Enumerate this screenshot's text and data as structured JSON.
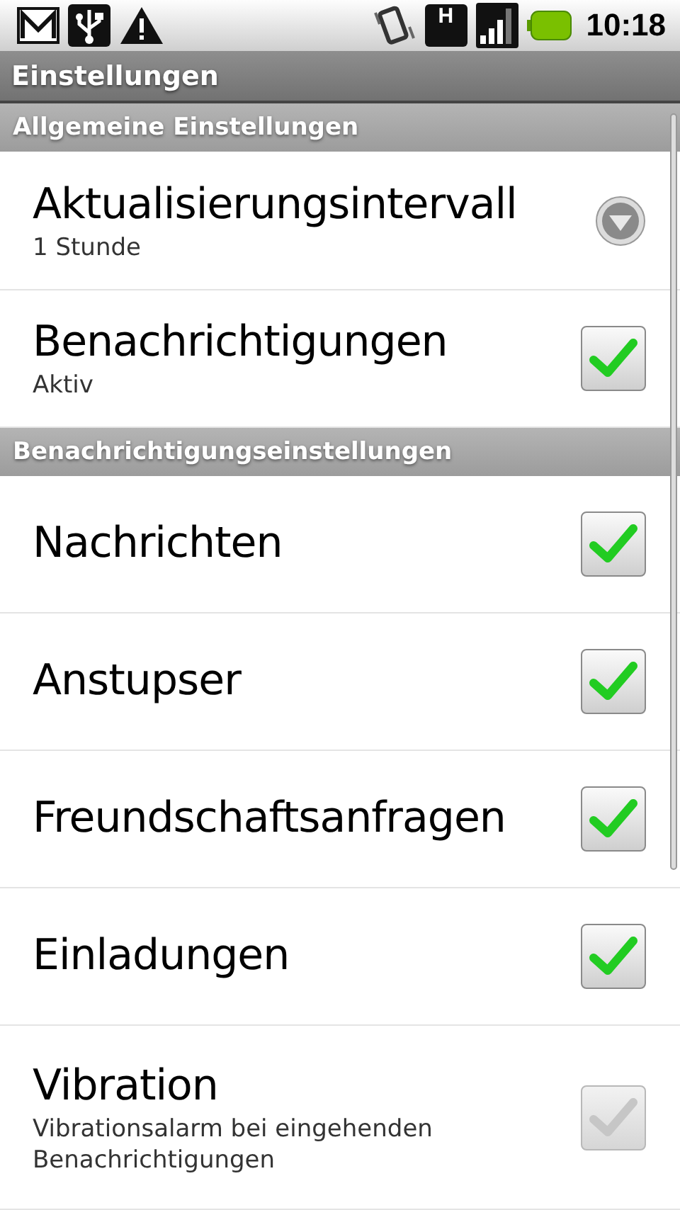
{
  "status_bar": {
    "network": "H",
    "time": "10:18"
  },
  "title": "Einstellungen",
  "sections": [
    {
      "header": "Allgemeine Einstellungen",
      "items": [
        {
          "kind": "list",
          "title": "Aktualisierungsintervall",
          "summary": "1 Stunde"
        },
        {
          "kind": "checkbox",
          "title": "Benachrichtigungen",
          "summary": "Aktiv",
          "checked": true,
          "disabled": false
        }
      ]
    },
    {
      "header": "Benachrichtigungseinstellungen",
      "items": [
        {
          "kind": "checkbox",
          "title": "Nachrichten",
          "checked": true,
          "disabled": false
        },
        {
          "kind": "checkbox",
          "title": "Anstupser",
          "checked": true,
          "disabled": false
        },
        {
          "kind": "checkbox",
          "title": "Freundschaftsanfragen",
          "checked": true,
          "disabled": false
        },
        {
          "kind": "checkbox",
          "title": "Einladungen",
          "checked": true,
          "disabled": false
        },
        {
          "kind": "checkbox",
          "title": "Vibration",
          "summary": "Vibrationsalarm bei eingehenden Benachrichtigungen",
          "checked": true,
          "disabled": true
        }
      ]
    }
  ]
}
